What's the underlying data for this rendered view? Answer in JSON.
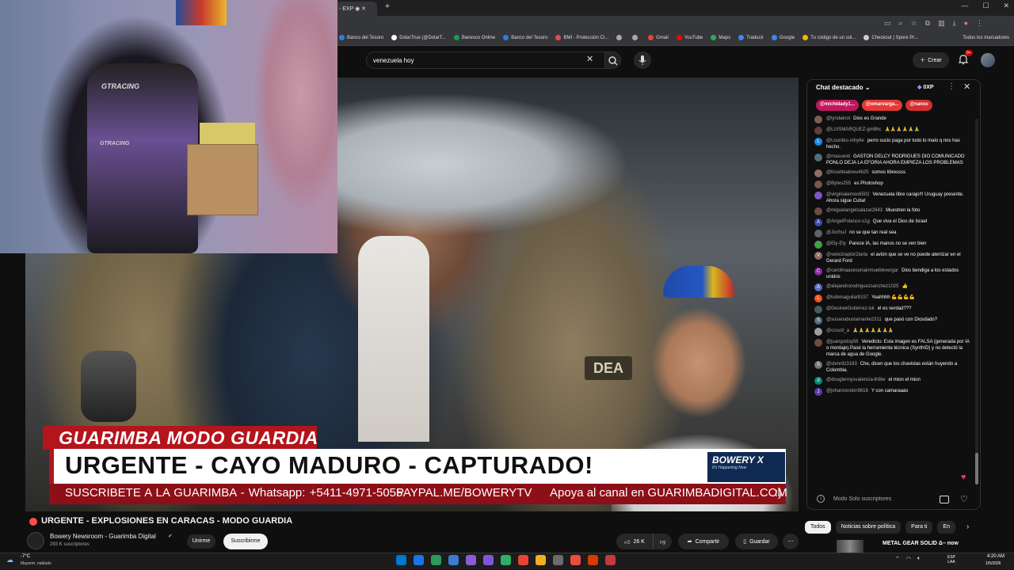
{
  "browser": {
    "tab_title": "- EXP",
    "bookmarks": [
      {
        "label": "Banco del Tesoro",
        "color": "#2c7be5"
      },
      {
        "label": "DolarTrue (@DolarT...",
        "color": "#ffffff"
      },
      {
        "label": "Banesco Online",
        "color": "#1a9e4b"
      },
      {
        "label": "Banco del Tesoro",
        "color": "#2c7be5"
      },
      {
        "label": "BMI - Protección Ci...",
        "color": "#e04b4b"
      },
      {
        "label": "",
        "color": "#aaaaaa"
      },
      {
        "label": "",
        "color": "#aaaaaa"
      },
      {
        "label": "Gmail",
        "color": "#ea4335"
      },
      {
        "label": "YouTube",
        "color": "#ff0000"
      },
      {
        "label": "Maps",
        "color": "#34a853"
      },
      {
        "label": "Traducir",
        "color": "#4285f4"
      },
      {
        "label": "Google",
        "color": "#4285f4"
      },
      {
        "label": "Tu código de un sol...",
        "color": "#f4b400"
      },
      {
        "label": "Checkout | Spore Pr...",
        "color": "#cccccc"
      }
    ],
    "all_bookmarks": "Todos los marcadores"
  },
  "youtube": {
    "search_query": "venezuela hoy",
    "create_label": "Crear",
    "notifications_badge": "9+"
  },
  "video": {
    "webcam": {
      "chair_brand_top": "GTRACING",
      "chair_brand_mid": "GTRACING"
    },
    "overlay": {
      "tag": "GUARIMBA MODO GUARDIA",
      "headline": "URGENTE - CAYO MADURO - CAPTURADO!",
      "ticker_1": "SUSCRIBETE A LA GUARIMBA - Whatsapp: +5411-4971-5055",
      "ticker_2": "PAYPAL.ME/BOWERYTV",
      "ticker_3": "Apoya al canal en GUARIMBADIGITAL.COM",
      "ticker_4": ":)",
      "logo_name": "BOWERY X",
      "logo_tagline": "It's Happening Now",
      "patch": "DEA"
    },
    "title": "URGENTE - EXPLOSIONES EN CARACAS - MODO GUARDIA",
    "channel_name": "Bowery Newsroom - Guarimba Digital",
    "channel_subs": "293 K suscriptores",
    "join_label": "Unirme",
    "subscribe_label": "Suscribirme",
    "likes": "26 K",
    "share_label": "Compartir",
    "save_label": "Guardar"
  },
  "chat": {
    "header": "Chat destacado",
    "xp": "0XP",
    "tickers": [
      {
        "name": "@michidady1...",
        "color": "#c2185b"
      },
      {
        "name": "@omarvarga...",
        "color": "#e53935"
      },
      {
        "name": "@nanoc",
        "color": "#d32f2f"
      }
    ],
    "messages": [
      {
        "initial": "",
        "color": "#7b5e57",
        "user": "@lyndakrol",
        "text": "Dios es Grande"
      },
      {
        "initial": "",
        "color": "#5d4037",
        "user": "@LUISMARQUEZ-gm9hc",
        "text": "🙏🙏🙏🙏🙏🙏"
      },
      {
        "initial": "L",
        "color": "#1e88e5",
        "user": "@Lourdes-mhy6e",
        "text": "perro sucio paga por todo lo malo q nos has hecho."
      },
      {
        "initial": "",
        "color": "#546e7a",
        "user": "@masuesti",
        "text": "GASTON DELCY RODRIGUES DIO COMUNICADO PONLO DEJA LA EFORIA AHORA EMPIEZA LOS PROBLEMAS"
      },
      {
        "initial": "",
        "color": "#8d6e63",
        "user": "@lissetteabreu4625",
        "text": "somos libressss"
      },
      {
        "initial": "",
        "color": "#795548",
        "user": "@Bytes255",
        "text": "es Photoshop"
      },
      {
        "initial": "",
        "color": "#7e57c2",
        "user": "@virginialemos6502",
        "text": "Venezuela libre carajo!!! Uruguay presente. Ahora sigue Cuba!"
      },
      {
        "initial": "",
        "color": "#6d4c41",
        "user": "@miguelangelsalazar2643",
        "text": "Muestren la foto"
      },
      {
        "initial": "A",
        "color": "#3949ab",
        "user": "@AngelPolanco-s1g",
        "text": "Que viva el Dios de Israel"
      },
      {
        "initial": "",
        "color": "#616161",
        "user": "@JochuJ",
        "text": "no se que tan real sea"
      },
      {
        "initial": "",
        "color": "#43a047",
        "user": "@Ely-Ely",
        "text": "Parece IA, las manos no se ven bien"
      },
      {
        "initial": "V",
        "color": "#8d6e63",
        "user": "@velociraptor2tarla",
        "text": "el avión que se ve no puede aterrizar en el Gerard Ford"
      },
      {
        "initial": "C",
        "color": "#8e24aa",
        "user": "@carolinaasesoriainmueblevergar",
        "text": "Dios bendiga a los estados unidos"
      },
      {
        "initial": "A",
        "color": "#5c6bc0",
        "user": "@alejandrorodriguezsanchez1025",
        "text": "👍"
      },
      {
        "initial": "L",
        "color": "#f4511e",
        "user": "@ludvinaguilar8157",
        "text": "Yeahhhh 💪💪💪💪"
      },
      {
        "initial": "",
        "color": "#455a64",
        "user": "@DesireeGutierrez-isk",
        "text": "el es verdad???"
      },
      {
        "initial": "S",
        "color": "#546e7a",
        "user": "@susanabustamante2311",
        "text": "que pasó con Diosdado?"
      },
      {
        "initial": "",
        "color": "#9e9e9e",
        "user": "@ccsvzl_a",
        "text": "🙏🙏🙏🙏🙏🙏🙏"
      },
      {
        "initial": "",
        "color": "#6d4c41",
        "user": "@juangodoy56",
        "text": "Veredicto: Esta imagen es FALSA (generada por IA o montaje).Pasé la herramienta técnica (SynthID) y no detectó la marca de agua de Google."
      },
      {
        "initial": "S",
        "color": "#757575",
        "user": "@stvnrdz3163",
        "text": "Che, dicen que los chavistas están huyendo a Colombia."
      },
      {
        "initial": "d",
        "color": "#00897b",
        "user": "@douglennysvalencia-lh8iw",
        "text": "el mion el mion"
      },
      {
        "initial": "J",
        "color": "#5e35b1",
        "user": "@johanrondon9618",
        "text": "Y con camaraaas"
      }
    ],
    "input_placeholder": "Modo Solo suscriptores"
  },
  "sidebar": {
    "chips": [
      "Todos",
      "Noticias sobre política",
      "Para ti",
      "En"
    ],
    "rec_title": "METAL GEAR SOLID Δ– now"
  },
  "taskbar": {
    "temp": "-7°C",
    "weather": "Mayorm. nublado",
    "lang_top": "ESP",
    "lang_bottom": "LAA",
    "time": "4:20 AM",
    "date": "1/5/2026",
    "apps": [
      "#0078d4",
      "#1a73e8",
      "#2b9a5a",
      "#3b7bd4",
      "#8c5bd6",
      "#7f56d9",
      "#2eaf67",
      "#ea4335",
      "#f2b01e",
      "#6b6b6b",
      "#e94e3d",
      "#d83b01",
      "#c23a3a"
    ]
  }
}
